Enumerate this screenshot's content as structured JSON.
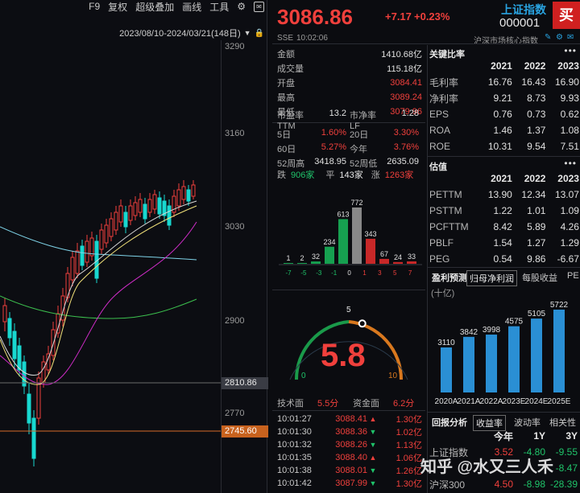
{
  "toolbar": {
    "items": [
      "F9",
      "复权",
      "超级叠加",
      "画线",
      "工具"
    ],
    "date_range": "2023/08/10-2024/03/21(148日)"
  },
  "price_axis": {
    "labels": [
      "3290",
      "3160",
      "3030",
      "2900",
      "2770"
    ],
    "current_tag": "2810.86",
    "low_tag": "2745.60"
  },
  "quote": {
    "price": "3086.86",
    "change": "+7.17",
    "change_pct": "+0.23%",
    "exchange": "SSE",
    "time": "10:02:06",
    "index_name": "上证指数",
    "index_code": "000001",
    "index_desc": "沪深市场核心指数",
    "buy_button": "买",
    "stats": [
      {
        "label": "金额",
        "value": "1410.68亿",
        "color": "white"
      },
      {
        "label": "成交量",
        "value": "115.18亿",
        "color": "white"
      },
      {
        "label": "开盘",
        "value": "3084.41",
        "color": "red"
      },
      {
        "label": "最高",
        "value": "3089.24",
        "color": "red"
      },
      {
        "label": "最低",
        "value": "3079.96",
        "color": "red"
      }
    ],
    "pairs": [
      [
        {
          "label": "市盈率TTM",
          "value": "13.2",
          "color": "white"
        },
        {
          "label": "市净率LF",
          "value": "1.28",
          "color": "white"
        }
      ],
      [
        {
          "label": "5日",
          "value": "1.60%",
          "color": "red"
        },
        {
          "label": "20日",
          "value": "3.30%",
          "color": "red"
        }
      ],
      [
        {
          "label": "60日",
          "value": "5.27%",
          "color": "red"
        },
        {
          "label": "今年",
          "value": "3.76%",
          "color": "red"
        }
      ],
      [
        {
          "label": "52周高",
          "value": "3418.95",
          "color": "white"
        },
        {
          "label": "52周低",
          "value": "2635.09",
          "color": "white"
        }
      ]
    ],
    "breadth": {
      "down_label": "跌",
      "down": "906家",
      "flat_label": "平",
      "flat": "143家",
      "up_label": "涨",
      "up": "1263家"
    }
  },
  "distribution": {
    "ticks": [
      "-7",
      "-5",
      "-3",
      "-1",
      "0",
      "1",
      "3",
      "5",
      "7"
    ],
    "counts": [
      1,
      2,
      32,
      234,
      613,
      772,
      343,
      67,
      24,
      33
    ],
    "colors": [
      "green",
      "green",
      "green",
      "green",
      "green",
      "gray",
      "red",
      "red",
      "red",
      "red"
    ]
  },
  "gauge": {
    "value": "5.8",
    "min": "0",
    "mid": "5",
    "max": "10",
    "level": 0.58
  },
  "scores": {
    "tech_label": "技术面",
    "tech_value": "5.5分",
    "fund_label": "资金面",
    "fund_value": "6.2分"
  },
  "trades": [
    {
      "time": "10:01:27",
      "price": "3088.41",
      "dir": "up",
      "vol": "1.30亿"
    },
    {
      "time": "10:01:30",
      "price": "3088.36",
      "dir": "down",
      "vol": "1.02亿"
    },
    {
      "time": "10:01:32",
      "price": "3088.26",
      "dir": "down",
      "vol": "1.13亿"
    },
    {
      "time": "10:01:35",
      "price": "3088.40",
      "dir": "up",
      "vol": "1.06亿"
    },
    {
      "time": "10:01:38",
      "price": "3088.01",
      "dir": "down",
      "vol": "1.26亿"
    },
    {
      "time": "10:01:42",
      "price": "3087.99",
      "dir": "down",
      "vol": "1.30亿"
    }
  ],
  "key_ratios": {
    "title": "关键比率",
    "years": [
      "2021",
      "2022",
      "2023"
    ],
    "rows": [
      {
        "name": "毛利率",
        "vals": [
          "16.76",
          "16.43",
          "16.90"
        ]
      },
      {
        "name": "净利率",
        "vals": [
          "9.21",
          "8.73",
          "9.93"
        ]
      },
      {
        "name": "EPS",
        "vals": [
          "0.76",
          "0.73",
          "0.62"
        ]
      },
      {
        "name": "ROA",
        "vals": [
          "1.46",
          "1.37",
          "1.08"
        ]
      },
      {
        "name": "ROE",
        "vals": [
          "10.31",
          "9.54",
          "7.51"
        ]
      }
    ]
  },
  "valuation": {
    "title": "估值",
    "years": [
      "2021",
      "2022",
      "2023"
    ],
    "rows": [
      {
        "name": "PETTM",
        "vals": [
          "13.90",
          "12.34",
          "13.07"
        ]
      },
      {
        "name": "PSTTM",
        "vals": [
          "1.22",
          "1.01",
          "1.09"
        ]
      },
      {
        "name": "PCFTTM",
        "vals": [
          "8.42",
          "5.89",
          "4.26"
        ]
      },
      {
        "name": "PBLF",
        "vals": [
          "1.54",
          "1.27",
          "1.29"
        ]
      },
      {
        "name": "PEG",
        "vals": [
          "0.54",
          "9.86",
          "-6.67"
        ]
      }
    ]
  },
  "forecast": {
    "tabs": [
      "盈利预测",
      "归母净利润",
      "每股收益",
      "PE"
    ],
    "unit": "(十亿)",
    "categories": [
      "2020A",
      "2021A",
      "2022A",
      "2023E",
      "2024E",
      "2025E"
    ],
    "values": [
      3110,
      3842,
      3998,
      4575,
      5105,
      5722
    ]
  },
  "returns": {
    "tabs": [
      "回报分析",
      "收益率",
      "波动率",
      "相关性"
    ],
    "periods": [
      "今年",
      "1Y",
      "3Y"
    ],
    "rows": [
      {
        "name": "上证指数",
        "vals": [
          "3.52",
          "-4.80",
          "-9.55"
        ],
        "colors": [
          "red",
          "green",
          "green"
        ]
      },
      {
        "name": "",
        "vals": [
          "",
          "",
          "-8.47"
        ],
        "colors": [
          "red",
          "green",
          "green"
        ]
      },
      {
        "name": "沪深300",
        "vals": [
          "4.50",
          "-8.98",
          "-28.39"
        ],
        "colors": [
          "red",
          "green",
          "green"
        ]
      }
    ]
  },
  "watermark": "知乎 @水又三人禾",
  "colors": {
    "up": "#f0403c",
    "down": "#1fc36a",
    "accent": "#29a3e0",
    "bar": "#2a8fd4"
  }
}
